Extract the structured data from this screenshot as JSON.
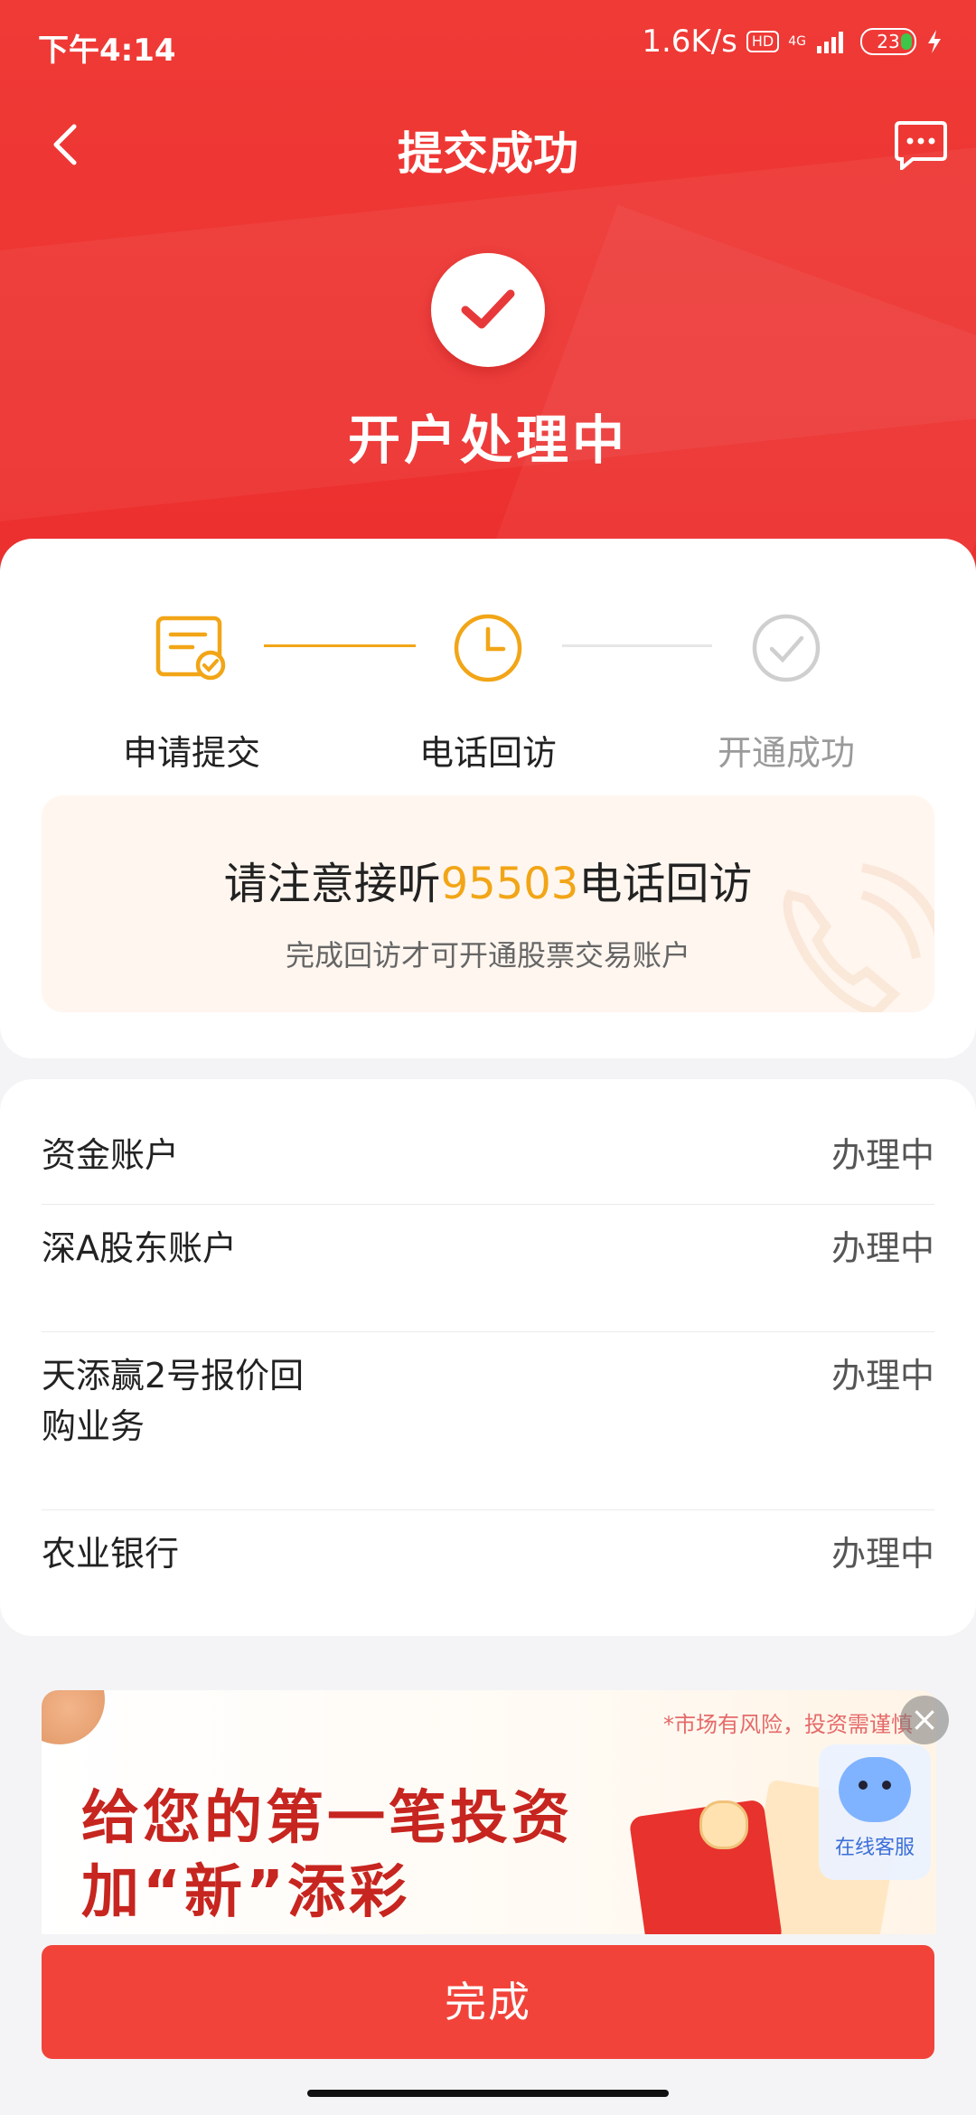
{
  "status_bar": {
    "time": "下午4:14",
    "speed": "1.6K/s",
    "hd": "HD",
    "network": "4G",
    "battery": "23"
  },
  "nav": {
    "title": "提交成功"
  },
  "hero": {
    "status_title": "开户处理中"
  },
  "steps": [
    {
      "label": "申请提交",
      "state": "done"
    },
    {
      "label": "电话回访",
      "state": "active"
    },
    {
      "label": "开通成功",
      "state": "pending"
    }
  ],
  "notice": {
    "prefix": "请注意接听",
    "phone": "95503",
    "suffix": "电话回访",
    "sub": "完成回访才可开通股票交易账户"
  },
  "accounts": [
    {
      "name": "资金账户",
      "status": "办理中"
    },
    {
      "name": "深A股东账户",
      "status": "办理中"
    },
    {
      "name_line1": "天添赢2号报价回",
      "name_line2": "购业务",
      "status": "办理中"
    },
    {
      "name": "农业银行",
      "status": "办理中"
    }
  ],
  "banner": {
    "disclaimer": "*市场有风险，投资需谨慎",
    "line1": "给您的第一笔投资",
    "line2": "加“新”添彩"
  },
  "service": {
    "label": "在线客服"
  },
  "done_button": "完成",
  "colors": {
    "primary_red": "#ec2f2e",
    "step_orange": "#f2a516",
    "button_red": "#f2433a"
  }
}
